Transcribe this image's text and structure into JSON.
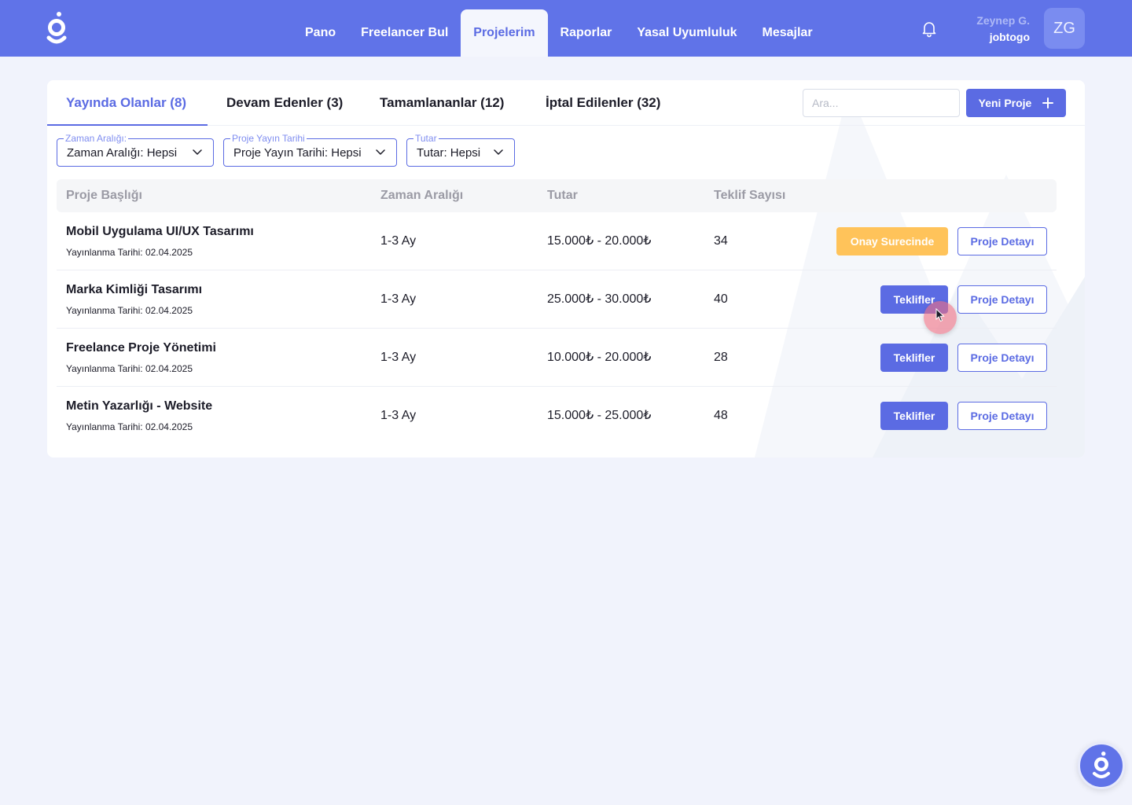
{
  "brand": {
    "primary_color": "#6073e8",
    "accent_color": "#5b6be3",
    "warning_color": "#ffc35a",
    "logo_icon": "jobtogo-logo-icon"
  },
  "nav": {
    "items": [
      {
        "label": "Pano"
      },
      {
        "label": "Freelancer Bul"
      },
      {
        "label": "Projelerim",
        "active": true
      },
      {
        "label": "Raporlar"
      },
      {
        "label": "Yasal Uyumluluk"
      },
      {
        "label": "Mesajlar"
      }
    ],
    "notification_icon": "bell-icon"
  },
  "user": {
    "name": "Zeynep G.",
    "org": "jobtogo",
    "initials": "ZG"
  },
  "tabs": [
    {
      "label": "Yayında Olanlar (8)",
      "active": true
    },
    {
      "label": "Devam Edenler (3)"
    },
    {
      "label": "Tamamlananlar (12)"
    },
    {
      "label": "İptal Edilenler (32)"
    }
  ],
  "search": {
    "placeholder": "Ara..."
  },
  "new_project_label": "Yeni Proje",
  "filters": [
    {
      "legend": "Zaman Aralığı:",
      "value": "Zaman Aralığı: Hepsi"
    },
    {
      "legend": "Proje Yayın Tarihi",
      "value": "Proje Yayın Tarihi: Hepsi"
    },
    {
      "legend": "Tutar",
      "value": "Tutar: Hepsi"
    }
  ],
  "table": {
    "columns": [
      "Proje Başlığı",
      "Zaman Aralığı",
      "Tutar",
      "Teklif Sayısı"
    ],
    "rows": [
      {
        "title": "Mobil Uygulama UI/UX Tasarımı",
        "date": "Yayınlanma Tarihi: 02.04.2025",
        "range": "1-3 Ay",
        "amount": "15.000₺ - 20.000₺",
        "offers": "34",
        "action": "Onay Surecinde",
        "action_type": "status",
        "detail": "Proje Detayı"
      },
      {
        "title": "Marka Kimliği Tasarımı",
        "date": "Yayınlanma Tarihi: 02.04.2025",
        "range": "1-3 Ay",
        "amount": "25.000₺ - 30.000₺",
        "offers": "40",
        "action": "Teklifler",
        "action_type": "offers",
        "detail": "Proje Detayı"
      },
      {
        "title": "Freelance Proje Yönetimi",
        "date": "Yayınlanma Tarihi: 02.04.2025",
        "range": "1-3 Ay",
        "amount": "10.000₺ - 20.000₺",
        "offers": "28",
        "action": "Teklifler",
        "action_type": "offers",
        "detail": "Proje Detayı"
      },
      {
        "title": "Metin Yazarlığı - Website",
        "date": "Yayınlanma Tarihi: 02.04.2025",
        "range": "1-3 Ay",
        "amount": "15.000₺ - 25.000₺",
        "offers": "48",
        "action": "Teklifler",
        "action_type": "offers",
        "detail": "Proje Detayı"
      }
    ]
  },
  "help_button_icon": "jobtogo-help-icon"
}
